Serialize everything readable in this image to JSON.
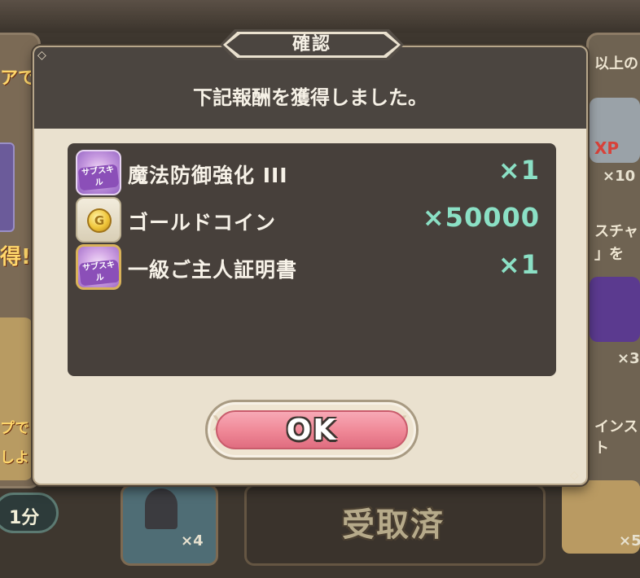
{
  "dialog": {
    "title": "確認",
    "message": "下記報酬を獲得しました。",
    "rewards": [
      {
        "icon": "sub-skill-icon",
        "icon_label": "サブスキル",
        "name": "魔法防御強化 III",
        "quantity": "×1"
      },
      {
        "icon": "gold-coin-icon",
        "icon_label": "G",
        "name": "ゴールドコイン",
        "quantity": "×50000"
      },
      {
        "icon": "sub-skill-gold-icon",
        "icon_label": "サブスキル",
        "name": "一級ご主人証明書",
        "quantity": "×1"
      }
    ],
    "ok_label": "OK"
  },
  "background": {
    "right_texts": [
      "以上の",
      "スチャ",
      "」を",
      "インスト"
    ],
    "left_texts": [
      "アで",
      "得!",
      "プで",
      "しよう"
    ],
    "timer": "1分",
    "received_label": "受取済",
    "counts": [
      "×10",
      "×3",
      "×4",
      "×5"
    ],
    "xp_label": "XP"
  },
  "colors": {
    "accent_quantity": "#8be0c5",
    "ok_button": "#ef8796",
    "dialog_header": "#4b4540"
  }
}
